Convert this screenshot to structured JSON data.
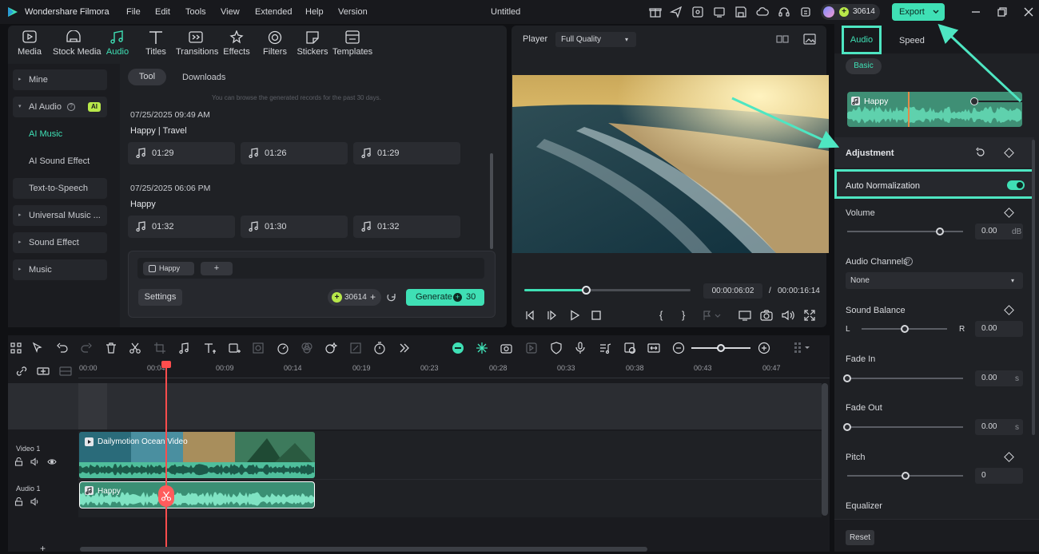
{
  "app": {
    "name": "Wondershare Filmora",
    "menu": [
      "File",
      "Edit",
      "Tools",
      "View",
      "Extended",
      "Help",
      "Version"
    ],
    "project_title": "Untitled",
    "credits": "30614",
    "export_label": "Export"
  },
  "media_tabs": [
    {
      "icon": "media-icon",
      "label": "Media"
    },
    {
      "icon": "stock-media-icon",
      "label": "Stock Media"
    },
    {
      "icon": "audio-icon",
      "label": "Audio"
    },
    {
      "icon": "titles-icon",
      "label": "Titles"
    },
    {
      "icon": "transitions-icon",
      "label": "Transitions"
    },
    {
      "icon": "effects-icon",
      "label": "Effects"
    },
    {
      "icon": "filters-icon",
      "label": "Filters"
    },
    {
      "icon": "stickers-icon",
      "label": "Stickers"
    },
    {
      "icon": "templates-icon",
      "label": "Templates"
    }
  ],
  "sidebar": {
    "mine": "Mine",
    "ai_audio": "AI Audio",
    "ai_badge": "AI",
    "ai_music": "AI Music",
    "ai_sound_effect": "AI Sound Effect",
    "tts": "Text-to-Speech",
    "universal_music": "Universal Music ...",
    "sound_effect": "Sound Effect",
    "music": "Music"
  },
  "browser": {
    "tab_tool": "Tool",
    "tab_downloads": "Downloads",
    "hint": "You can browse the generated records for the past 30 days.",
    "groups": [
      {
        "date": "07/25/2025 09:49 AM",
        "title": "Happy | Travel",
        "tracks": [
          "01:29",
          "01:26",
          "01:29"
        ]
      },
      {
        "date": "07/25/2025 06:06 PM",
        "title": "Happy",
        "tracks": [
          "01:32",
          "01:30",
          "01:32"
        ]
      }
    ],
    "tag": "Happy",
    "add_tag": "+",
    "settings": "Settings",
    "credits": "30614",
    "generate": "Generate",
    "generate_cost": "30"
  },
  "player": {
    "label": "Player",
    "quality": "Full Quality",
    "progress": 0.37,
    "current_time": "00:00:06:02",
    "separator": "/",
    "total_time": "00:00:16:14"
  },
  "timeline": {
    "ticks": [
      "00:00",
      "00:04",
      "00:09",
      "00:14",
      "00:19",
      "00:23",
      "00:28",
      "00:33",
      "00:38",
      "00:43",
      "00:47"
    ],
    "video_track": "Video 1",
    "audio_track": "Audio 1",
    "video_clip": "Dailymotion Ocean Video",
    "audio_clip": "Happy"
  },
  "inspector": {
    "tab_audio": "Audio",
    "tab_speed": "Speed",
    "basic": "Basic",
    "clip_name": "Happy",
    "adjustment": "Adjustment",
    "auto_normalization": "Auto Normalization",
    "auto_normalization_on": true,
    "volume": {
      "label": "Volume",
      "value": "0.00",
      "unit": "dB",
      "level": 0.8
    },
    "audio_channels": {
      "label": "Audio Channels",
      "value": "None"
    },
    "sound_balance": {
      "label": "Sound Balance",
      "left": "L",
      "right": "R",
      "value": "0.00",
      "level": 0.5
    },
    "fade_in": {
      "label": "Fade In",
      "value": "0.00",
      "unit": "s",
      "level": 0
    },
    "fade_out": {
      "label": "Fade Out",
      "value": "0.00",
      "unit": "s",
      "level": 0
    },
    "pitch": {
      "label": "Pitch",
      "value": "0",
      "level": 0.5
    },
    "equalizer": "Equalizer",
    "reset": "Reset"
  },
  "colors": {
    "accent": "#3fe0b5",
    "highlight_box": "#4ee6c2",
    "playhead": "#ff4d4d",
    "panel": "#1f2125"
  }
}
